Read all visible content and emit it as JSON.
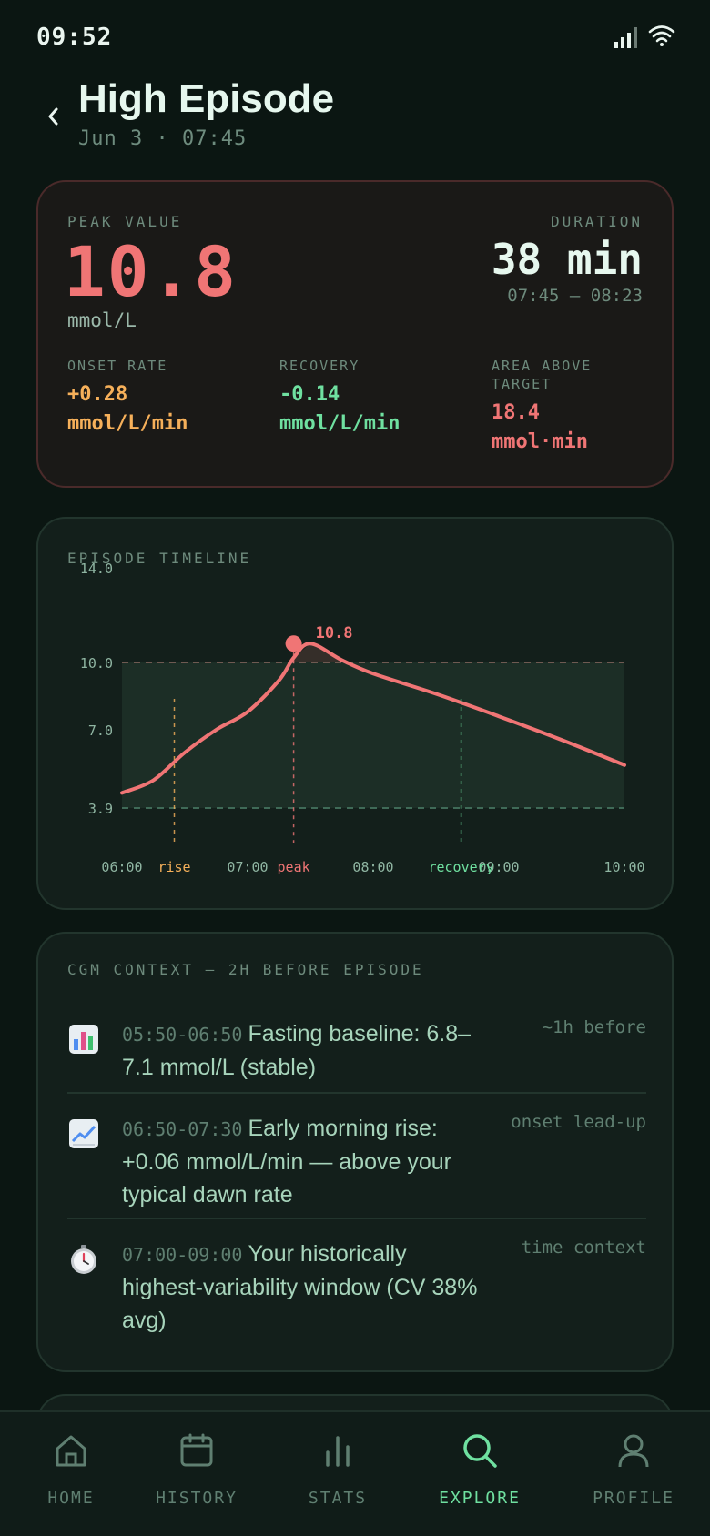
{
  "status": {
    "time": "09:52"
  },
  "header": {
    "title": "High Episode",
    "subtitle": "Jun 3 · 07:45"
  },
  "summary": {
    "peak_label": "PEAK VALUE",
    "peak_value": "10.8",
    "peak_unit": "mmol/L",
    "duration_label": "DURATION",
    "duration_value": "38 min",
    "duration_range": "07:45 – 08:23",
    "metrics": [
      {
        "label": "ONSET RATE",
        "value": "+0.28",
        "unit": "mmol/L/min",
        "color": "#f6b05a"
      },
      {
        "label": "RECOVERY",
        "value": "-0.14",
        "unit": "mmol/L/min",
        "color": "#6fe0a0"
      },
      {
        "label": "AREA ABOVE TARGET",
        "value": "18.4",
        "unit": "mmol·min",
        "color": "#f07575"
      }
    ]
  },
  "timeline": {
    "title": "EPISODE TIMELINE",
    "markers": {
      "rise": "rise",
      "peak": "peak",
      "recovery": "recovery"
    },
    "peak_label": "10.8"
  },
  "chart_data": {
    "type": "line",
    "x_ticks": [
      "06:00",
      "07:00",
      "08:00",
      "09:00",
      "10:00"
    ],
    "y_ticks": [
      "14.0",
      "10.0",
      "7.0",
      "3.9"
    ],
    "target_range": [
      3.9,
      10.0
    ],
    "x": [
      "06:00",
      "06:15",
      "06:30",
      "06:45",
      "07:00",
      "07:15",
      "07:22",
      "07:30",
      "07:45",
      "08:00",
      "08:30",
      "09:00",
      "09:30",
      "10:00"
    ],
    "values": [
      4.5,
      5.0,
      6.1,
      7.0,
      7.8,
      9.2,
      10.2,
      10.8,
      10.1,
      9.5,
      8.6,
      7.6,
      6.6,
      5.6
    ],
    "annotations": [
      {
        "label": "rise",
        "x": "06:25",
        "color": "#f6b05a"
      },
      {
        "label": "peak",
        "x": "07:22",
        "color": "#f07575"
      },
      {
        "label": "recovery",
        "x": "08:42",
        "color": "#6fe0a0"
      }
    ],
    "peak": {
      "x": "07:22",
      "y": 10.8
    },
    "colors": {
      "line": "#f07575",
      "target_fill": "#1c2e26",
      "dashed": "#6f5a52"
    }
  },
  "context": {
    "title": "CGM CONTEXT — 2H BEFORE EPISODE",
    "items": [
      {
        "icon": "bar-chart-icon",
        "time": "05:50-06:50",
        "text": "Fasting baseline: 6.8–7.1 mmol/L (stable)",
        "tag": "~1h before"
      },
      {
        "icon": "trend-up-icon",
        "time": "06:50-07:30",
        "text": "Early morning rise: +0.06 mmol/L/min — above your typical dawn rate",
        "tag": "onset lead-up"
      },
      {
        "icon": "stopwatch-icon",
        "time": "07:00-09:00",
        "text": "Your historically highest-variability window (CV 38% avg)",
        "tag": "time context"
      }
    ]
  },
  "tabs": [
    {
      "label": "HOME",
      "icon": "home-icon",
      "active": false
    },
    {
      "label": "HISTORY",
      "icon": "calendar-icon",
      "active": false
    },
    {
      "label": "STATS",
      "icon": "stats-icon",
      "active": false
    },
    {
      "label": "EXPLORE",
      "icon": "search-icon",
      "active": true
    },
    {
      "label": "PROFILE",
      "icon": "person-icon",
      "active": false
    }
  ]
}
